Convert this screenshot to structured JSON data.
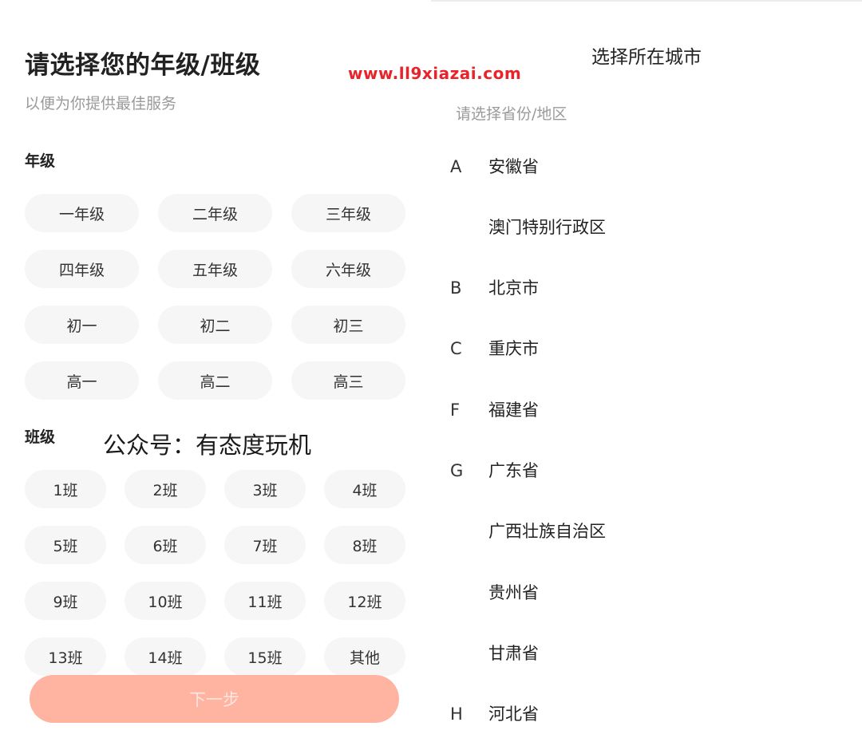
{
  "left": {
    "title": "请选择您的年级/班级",
    "subtitle": "以便为你提供最佳服务",
    "grade_label": "年级",
    "grades": [
      "一年级",
      "二年级",
      "三年级",
      "四年级",
      "五年级",
      "六年级",
      "初一",
      "初二",
      "初三",
      "高一",
      "高二",
      "高三"
    ],
    "class_label": "班级",
    "classes": [
      "1班",
      "2班",
      "3班",
      "4班",
      "5班",
      "6班",
      "7班",
      "8班",
      "9班",
      "10班",
      "11班",
      "12班",
      "13班",
      "14班",
      "15班",
      "其他"
    ],
    "next_button": "下一步"
  },
  "overlays": {
    "site_url": "www.ll9xiazai.com",
    "wechat_account": "公众号：有态度玩机"
  },
  "right": {
    "title": "选择所在城市",
    "hint": "请选择省份/地区",
    "provinces": [
      {
        "letter": "A",
        "name": "安徽省"
      },
      {
        "letter": "",
        "name": "澳门特别行政区"
      },
      {
        "letter": "B",
        "name": "北京市"
      },
      {
        "letter": "C",
        "name": "重庆市"
      },
      {
        "letter": "F",
        "name": "福建省"
      },
      {
        "letter": "G",
        "name": "广东省"
      },
      {
        "letter": "",
        "name": "广西壮族自治区"
      },
      {
        "letter": "",
        "name": "贵州省"
      },
      {
        "letter": "",
        "name": "甘肃省"
      },
      {
        "letter": "H",
        "name": "河北省"
      }
    ]
  },
  "colors": {
    "next_button_bg": "#ffb4a1",
    "chip_bg": "#f6f6f6",
    "watermark_red": "#e8232a"
  }
}
